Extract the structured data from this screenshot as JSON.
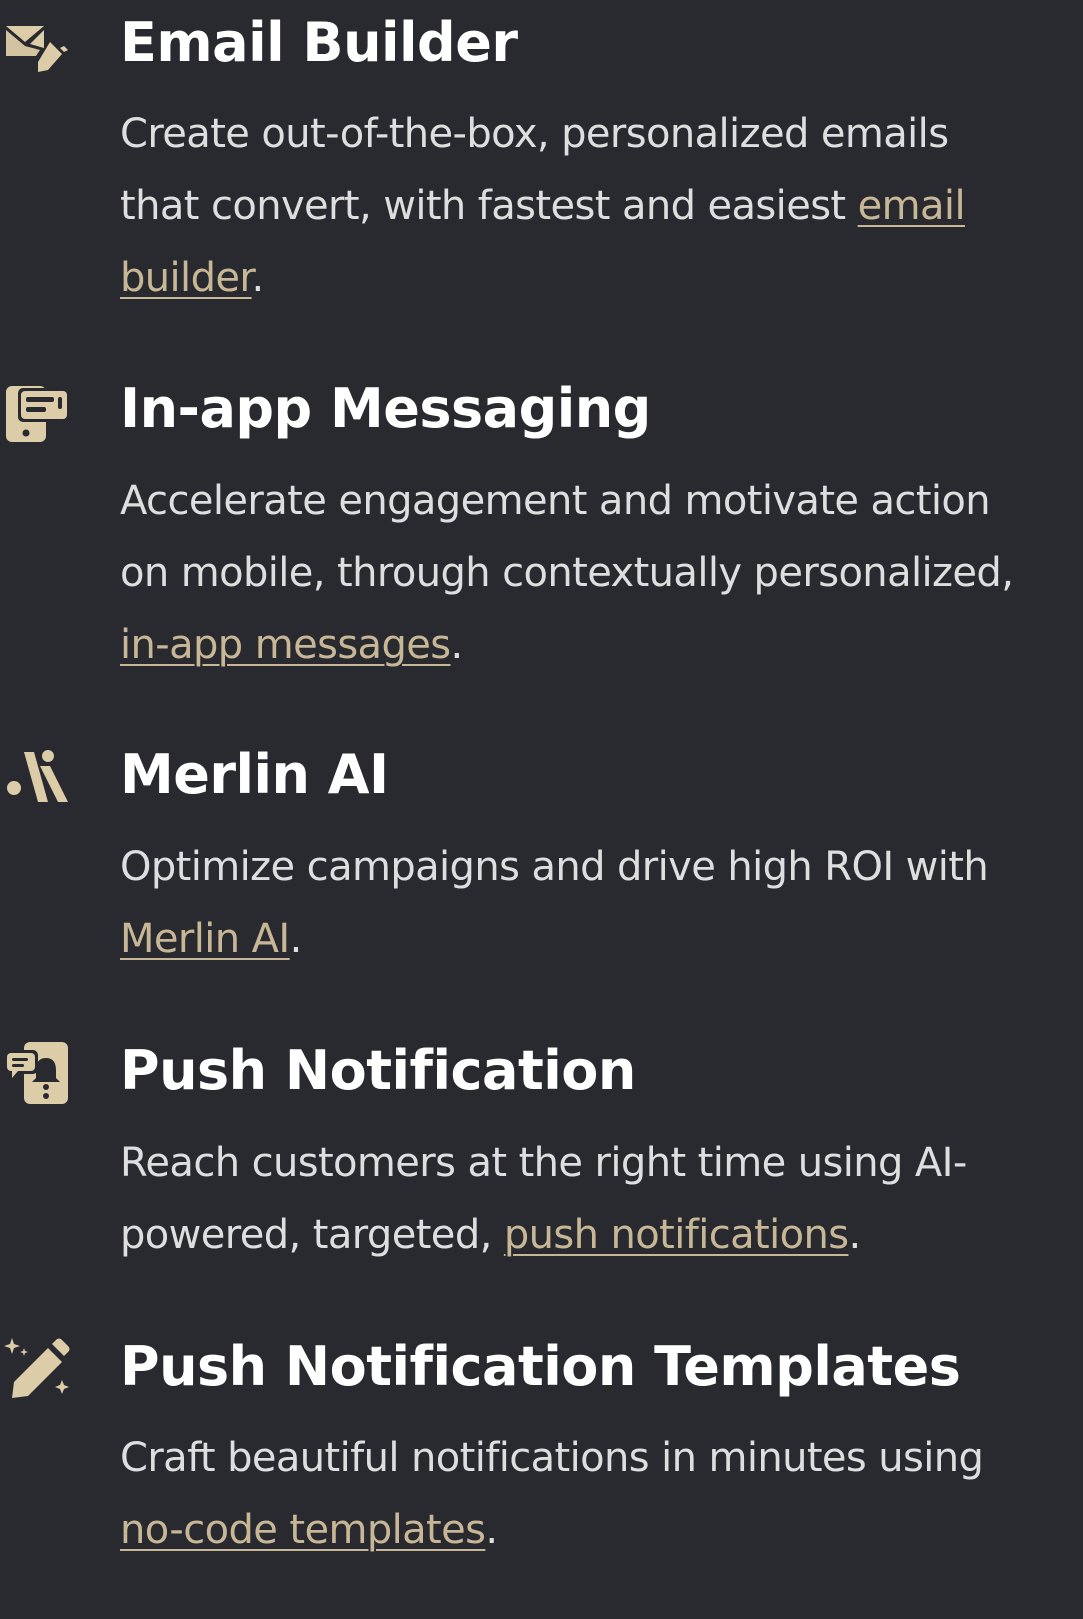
{
  "colors": {
    "background": "#282a2f",
    "title": "#ffffff",
    "text": "#dedede",
    "link": "#c8b796",
    "icon": "#dccca8"
  },
  "features": [
    {
      "icon": "envelope-edit-icon",
      "title": "Email Builder",
      "lines": [
        "Create out-of-the-box, personalized emails",
        "that convert, with fastest and easiest "
      ],
      "link_parts": [
        "email",
        "builder"
      ],
      "after": "."
    },
    {
      "icon": "in-app-message-icon",
      "title": "In-app Messaging",
      "lines": [
        "Accelerate engagement and motivate action",
        "on mobile, through contextually personalized,"
      ],
      "link": "in-app messages",
      "after": "."
    },
    {
      "icon": "merlin-ai-logo-icon",
      "title": "Merlin AI",
      "lines": [
        "Optimize campaigns and drive high ROI with"
      ],
      "link": "Merlin AI",
      "after": "."
    },
    {
      "icon": "push-notification-icon",
      "title": "Push Notification",
      "lines": [
        "Reach customers at the right time using AI-",
        "powered, targeted, "
      ],
      "link": "push notifications",
      "after": "."
    },
    {
      "icon": "magic-pencil-icon",
      "title": "Push Notification Templates",
      "lines": [
        "Craft beautiful notifications in minutes using"
      ],
      "link": "no-code templates",
      "after": "."
    }
  ]
}
